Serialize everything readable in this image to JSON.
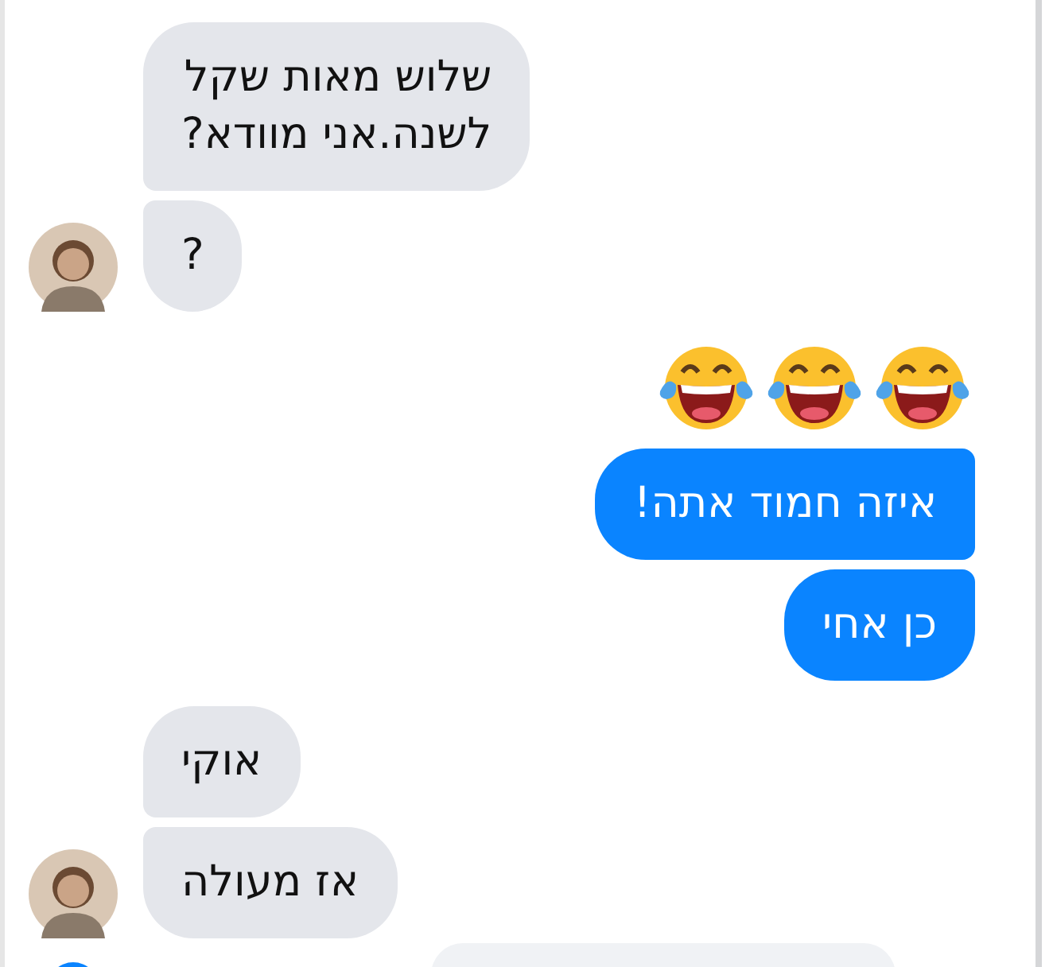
{
  "groups": [
    {
      "kind": "incoming",
      "items": [
        {
          "kind": "text",
          "text": "שלוש מאות שקל\nלשנה.אני מוודא?"
        },
        {
          "kind": "text",
          "text": "?"
        }
      ]
    },
    {
      "kind": "outgoing",
      "items": [
        {
          "kind": "emoji",
          "emojis": [
            {
              "kind": "tears-of-joy"
            },
            {
              "kind": "tears-of-joy"
            },
            {
              "kind": "tears-of-joy"
            }
          ]
        },
        {
          "kind": "text",
          "text": "איזה חמוד אתה!"
        },
        {
          "kind": "text",
          "text": "כן אחי"
        }
      ]
    },
    {
      "kind": "incoming",
      "items": [
        {
          "kind": "text",
          "text": "אוקי"
        },
        {
          "kind": "text",
          "text": "אז מעולה"
        }
      ]
    }
  ]
}
